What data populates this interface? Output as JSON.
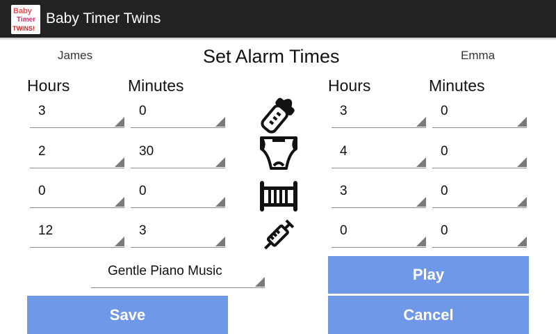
{
  "app": {
    "title": "Baby Timer Twins",
    "logo_lines": [
      "Baby",
      "Timer",
      "TWINS!"
    ]
  },
  "screen": {
    "heading": "Set Alarm Times",
    "left_name": "James",
    "right_name": "Emma",
    "hours_label": "Hours",
    "minutes_label": "Minutes"
  },
  "rows": [
    {
      "icon": "baby-bottle-icon",
      "left": {
        "hours": "3",
        "minutes": "0"
      },
      "right": {
        "hours": "3",
        "minutes": "0"
      }
    },
    {
      "icon": "diaper-icon",
      "left": {
        "hours": "2",
        "minutes": "30"
      },
      "right": {
        "hours": "4",
        "minutes": "0"
      }
    },
    {
      "icon": "crib-icon",
      "left": {
        "hours": "0",
        "minutes": "0"
      },
      "right": {
        "hours": "3",
        "minutes": "0"
      }
    },
    {
      "icon": "syringe-icon",
      "left": {
        "hours": "12",
        "minutes": "3"
      },
      "right": {
        "hours": "0",
        "minutes": "0"
      }
    }
  ],
  "sound": {
    "selected": "Gentle Piano Music"
  },
  "buttons": {
    "save": "Save",
    "play": "Play",
    "cancel": "Cancel"
  },
  "colors": {
    "accent": "#6f98e8",
    "actionbar": "#222222"
  }
}
